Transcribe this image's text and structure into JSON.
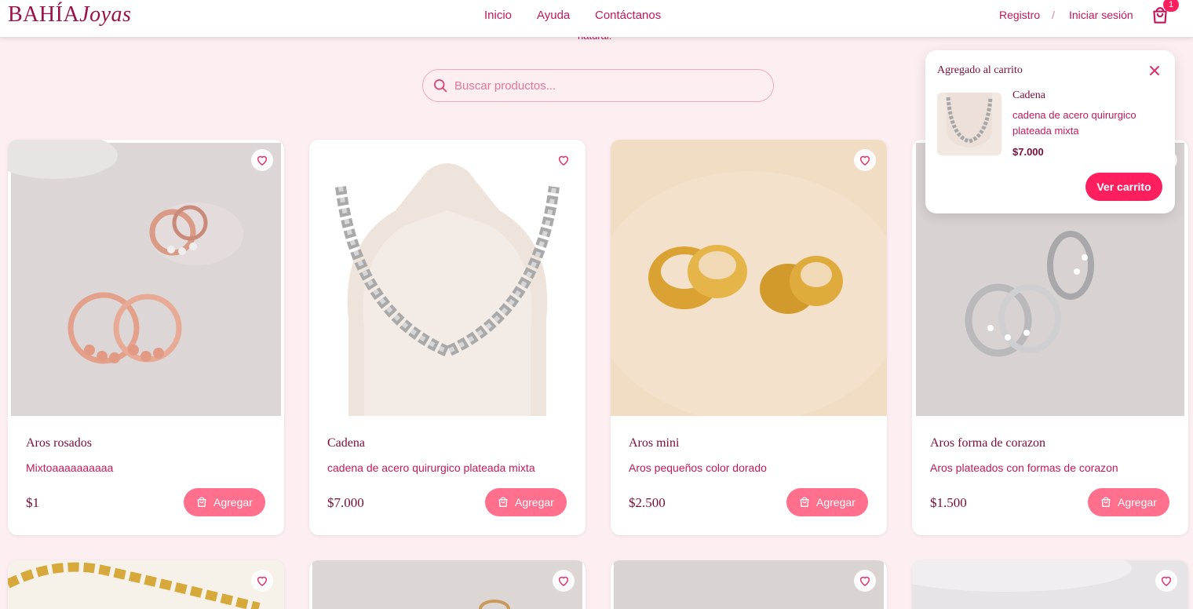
{
  "header": {
    "logo_part1": "BAHÍA",
    "logo_part2": "Joyas",
    "nav": [
      "Inicio",
      "Ayuda",
      "Contáctanos"
    ],
    "register": "Registro",
    "separator": "/",
    "login": "Iniciar sesión",
    "cart_count": "1"
  },
  "tagline_fragment": "natural.",
  "search": {
    "placeholder": "Buscar productos..."
  },
  "products": [
    {
      "title": "Aros rosados",
      "desc": "Mixtoaaaaaaaaaa",
      "price": "$1",
      "add_label": "Agregar"
    },
    {
      "title": "Cadena",
      "desc": "cadena de acero quirurgico plateada mixta",
      "price": "$7.000",
      "add_label": "Agregar"
    },
    {
      "title": "Aros mini",
      "desc": "Aros pequeños color dorado",
      "price": "$2.500",
      "add_label": "Agregar"
    },
    {
      "title": "Aros forma de corazon",
      "desc": "Aros plateados con formas de corazon",
      "price": "$1.500",
      "add_label": "Agregar"
    }
  ],
  "popup": {
    "title": "Agregado al carrito",
    "item_name": "Cadena",
    "item_desc": "cadena de acero quirurgico plateada mixta",
    "item_price": "$7.000",
    "button": "Ver carrito"
  },
  "colors": {
    "brand": "#9b1048",
    "accent": "#ff1f5e",
    "button": "#ff6f8e",
    "background": "#fdeef1"
  }
}
